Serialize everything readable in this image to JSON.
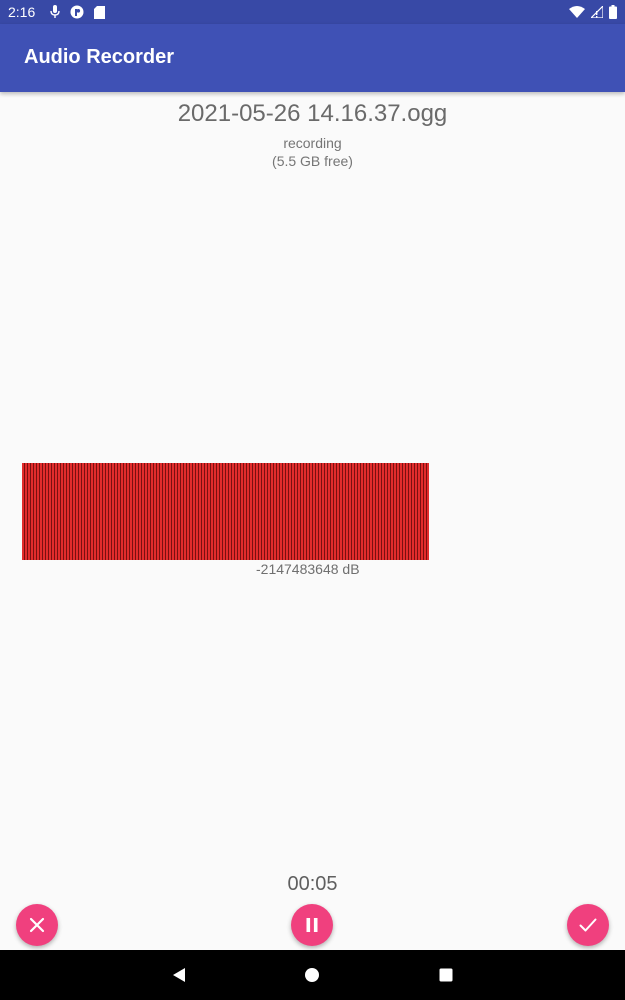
{
  "status_bar": {
    "time": "2:16",
    "left_icons": [
      "microphone-icon",
      "app-icon",
      "sd-card-icon"
    ],
    "right_icons": [
      "wifi-icon",
      "signal-icon",
      "battery-icon"
    ]
  },
  "app_bar": {
    "title": "Audio Recorder"
  },
  "recording": {
    "file_name": "2021-05-26 14.16.37.ogg",
    "state": "recording",
    "free_space": "(5.5 GB free)",
    "level_db": "-2147483648 dB",
    "elapsed": "00:05"
  },
  "actions": {
    "cancel_icon": "close-icon",
    "pause_icon": "pause-icon",
    "done_icon": "check-icon"
  },
  "colors": {
    "app_bar": "#3f51b5",
    "status_bar": "#3849a6",
    "accent": "#f0407e",
    "level_bar": "#e22c2c"
  }
}
